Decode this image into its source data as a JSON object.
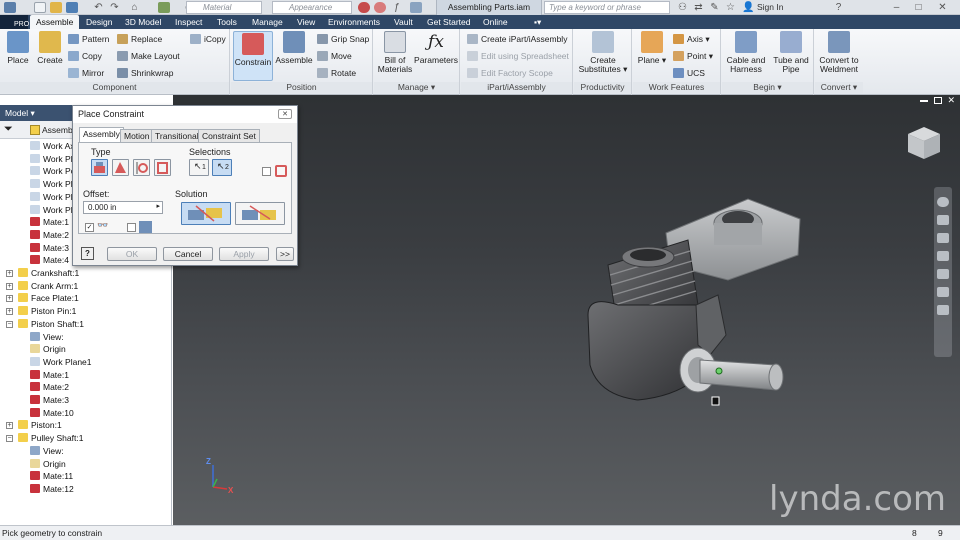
{
  "titlebar": {
    "material_placeholder": "Material",
    "appearance_placeholder": "Appearance",
    "document_title": "Assembling Parts.iam",
    "search_placeholder": "Type a keyword or phrase",
    "sign_in": "Sign In"
  },
  "pro_badge": "PRO",
  "tabs": [
    "Assemble",
    "Design",
    "3D Model",
    "Inspect",
    "Tools",
    "Manage",
    "View",
    "Environments",
    "Vault",
    "Get Started",
    "Online"
  ],
  "ribbon": {
    "component": {
      "label": "Component",
      "place": "Place",
      "create": "Create",
      "pattern": "Pattern",
      "copy": "Copy",
      "mirror": "Mirror",
      "replace": "Replace",
      "make_layout": "Make Layout",
      "shrinkwrap": "Shrinkwrap",
      "icopy": "iCopy"
    },
    "position": {
      "label": "Position",
      "constrain": "Constrain",
      "assemble": "Assemble",
      "grip_snap": "Grip Snap",
      "move": "Move",
      "rotate": "Rotate"
    },
    "manage": {
      "label": "Manage",
      "bill_of_materials_1": "Bill of",
      "bill_of_materials_2": "Materials",
      "parameters": "Parameters"
    },
    "ipart": {
      "label": "iPart/iAssembly",
      "create": "Create iPart/iAssembly",
      "edit_spreadsheet": "Edit using Spreadsheet",
      "edit_factory": "Edit Factory Scope"
    },
    "productivity": {
      "label": "Productivity",
      "create_1": "Create",
      "create_2": "Substitutes"
    },
    "work_features": {
      "label": "Work Features",
      "plane": "Plane",
      "axis": "Axis",
      "point": "Point",
      "ucs": "UCS"
    },
    "begin": {
      "label": "Begin",
      "cable_1": "Cable and",
      "cable_2": "Harness",
      "tube_1": "Tube and",
      "tube_2": "Pipe"
    },
    "convert": {
      "label": "Convert",
      "weld_1": "Convert to",
      "weld_2": "Weldment"
    }
  },
  "browser": {
    "title": "Model",
    "root": "Assemb",
    "items": [
      "Work Ax",
      "Work Pla",
      "Work Po",
      "Work Pla",
      "Work Pla",
      "Work Pla",
      "Mate:1",
      "Mate:2",
      "Mate:3",
      "Mate:4",
      "Crankshaft:1",
      "Crank Arm:1",
      "Face Plate:1",
      "Piston Pin:1",
      "Piston Shaft:1",
      "View:",
      "Origin",
      "Work Plane1",
      "Mate:1",
      "Mate:2",
      "Mate:3",
      "Mate:10",
      "Piston:1",
      "Pulley Shaft:1",
      "View:",
      "Origin",
      "Mate:11",
      "Mate:12"
    ]
  },
  "dialog": {
    "title": "Place Constraint",
    "tabs": [
      "Assembly",
      "Motion",
      "Transitional",
      "Constraint Set"
    ],
    "type_label": "Type",
    "selections_label": "Selections",
    "sel1": "1",
    "sel2": "2",
    "offset_label": "Offset:",
    "offset_value": "0.000 in",
    "solution_label": "Solution",
    "ok": "OK",
    "cancel": "Cancel",
    "apply": "Apply",
    "more": ">>"
  },
  "viewport": {
    "watermark": "lynda.com",
    "axis_x": "X",
    "axis_z": "Z"
  },
  "status": {
    "message": "Pick geometry to constrain",
    "count1": "8",
    "count2": "9"
  },
  "colors": {
    "tab_bar": "#2f4766",
    "browser_header": "#3b5270",
    "selection_blue": "#c7dcf3",
    "component_yellow": "#f3cf4b",
    "constraint_red": "#c8323c"
  }
}
